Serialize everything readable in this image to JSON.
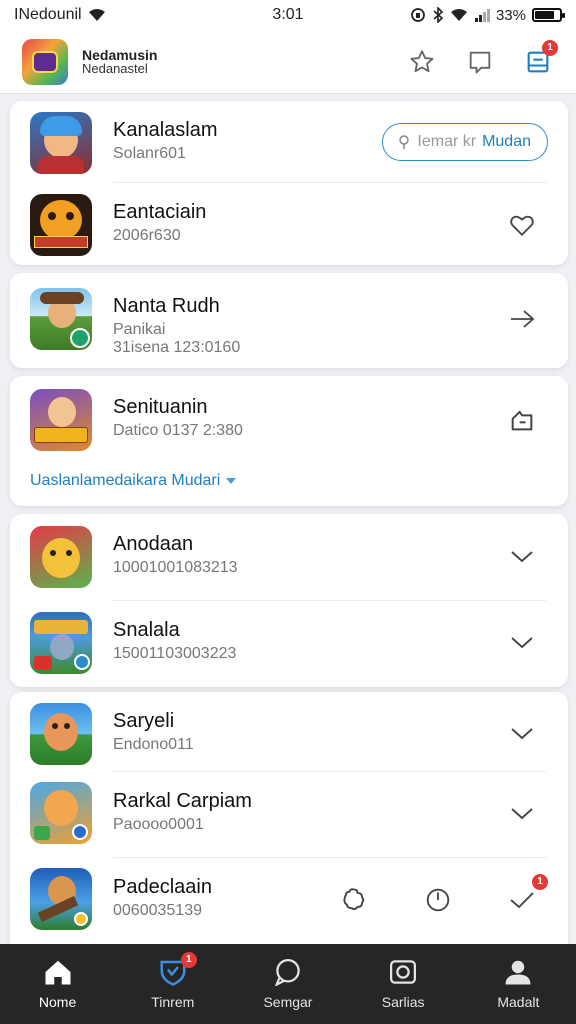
{
  "status": {
    "carrier": "INedounil",
    "time": "3:01",
    "battery_text": "33%",
    "battery_level": 0.8
  },
  "header": {
    "title": "Nedamusin",
    "subtitle": "Nedanastel",
    "notification_count": "1"
  },
  "card1": {
    "rows": [
      {
        "name": "Kanalaslam",
        "sub": "Solanr601",
        "pill_placeholder": "Iemar kr",
        "pill_accent": "Mudan"
      },
      {
        "name": "Eantaciain",
        "sub": "2006r630"
      }
    ]
  },
  "card2": {
    "rows": [
      {
        "name": "Nanta Rudh",
        "sub": "Panikai",
        "sub2": "31isena 123:0160"
      }
    ]
  },
  "card3": {
    "rows": [
      {
        "name": "Senituanin",
        "sub": "Datico 0137 2:380"
      }
    ],
    "expand_link": "Uaslanlamedaikara Mudari"
  },
  "card4": {
    "rows": [
      {
        "name": "Anodaan",
        "sub": "10001001083213"
      },
      {
        "name": "Snalala",
        "sub": "15001103003223"
      }
    ]
  },
  "card5": {
    "rows": [
      {
        "name": "Saryeli",
        "sub": "Endono011"
      },
      {
        "name": "Rarkal Carpiam",
        "sub": "Paoooo0001"
      },
      {
        "name": "Padeclaain",
        "sub": "0060035139",
        "badge": "1"
      }
    ]
  },
  "nav": {
    "items": [
      {
        "label": "Nome",
        "icon": "home-icon"
      },
      {
        "label": "Tinrem",
        "icon": "heart-shield-icon",
        "badge": "1"
      },
      {
        "label": "Semgar",
        "icon": "chat-bubble-icon"
      },
      {
        "label": "Sarlias",
        "icon": "camera-icon"
      },
      {
        "label": "Madalt",
        "icon": "user-icon"
      }
    ]
  },
  "colors": {
    "accent": "#1e7fc0",
    "badge": "#e53935",
    "nav_bg": "#262626"
  }
}
